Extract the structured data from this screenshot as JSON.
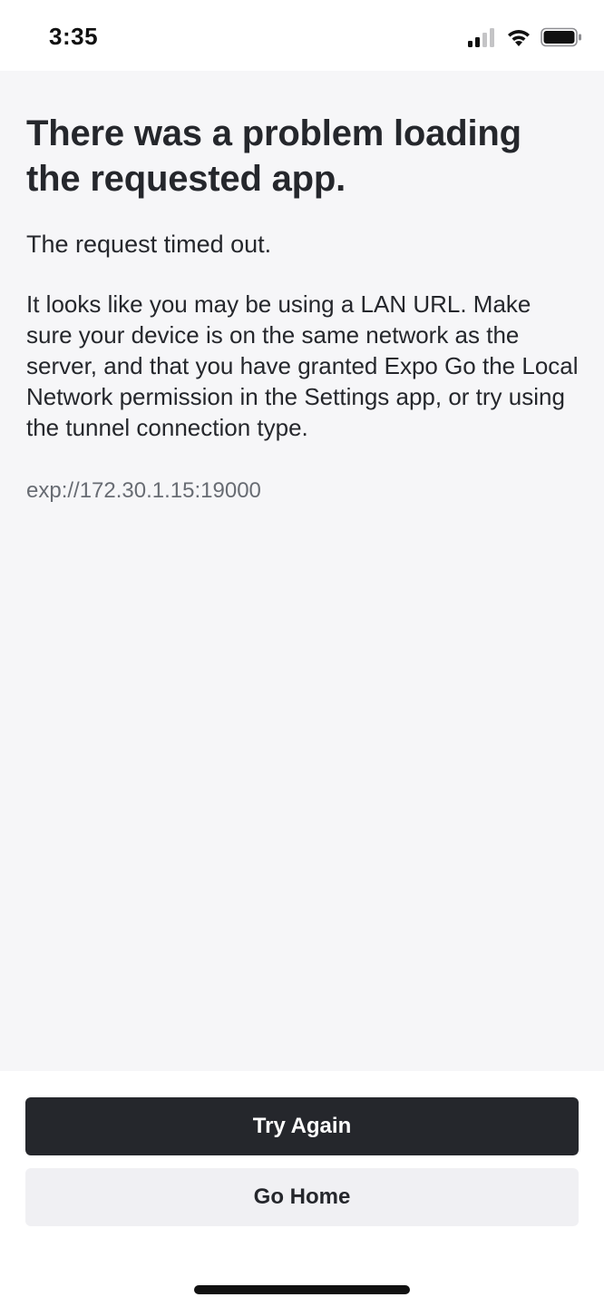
{
  "status_bar": {
    "time": "3:35",
    "icons": [
      "cellular-signal-icon",
      "wifi-icon",
      "battery-icon"
    ]
  },
  "error": {
    "title": "There was a problem loading the requested app.",
    "message": "The request timed out.",
    "explanation": "It looks like you may be using a LAN URL. Make sure your device is on the same network as the server, and that you have granted Expo Go the Local Network permission in the Settings app, or try using the tunnel connection type.",
    "url": "exp://172.30.1.15:19000"
  },
  "actions": {
    "try_again_label": "Try Again",
    "go_home_label": "Go Home"
  },
  "colors": {
    "primary_button": "#25272c",
    "secondary_button": "#f0f0f3",
    "content_background": "#f6f6f8",
    "url_text": "#686c73"
  }
}
